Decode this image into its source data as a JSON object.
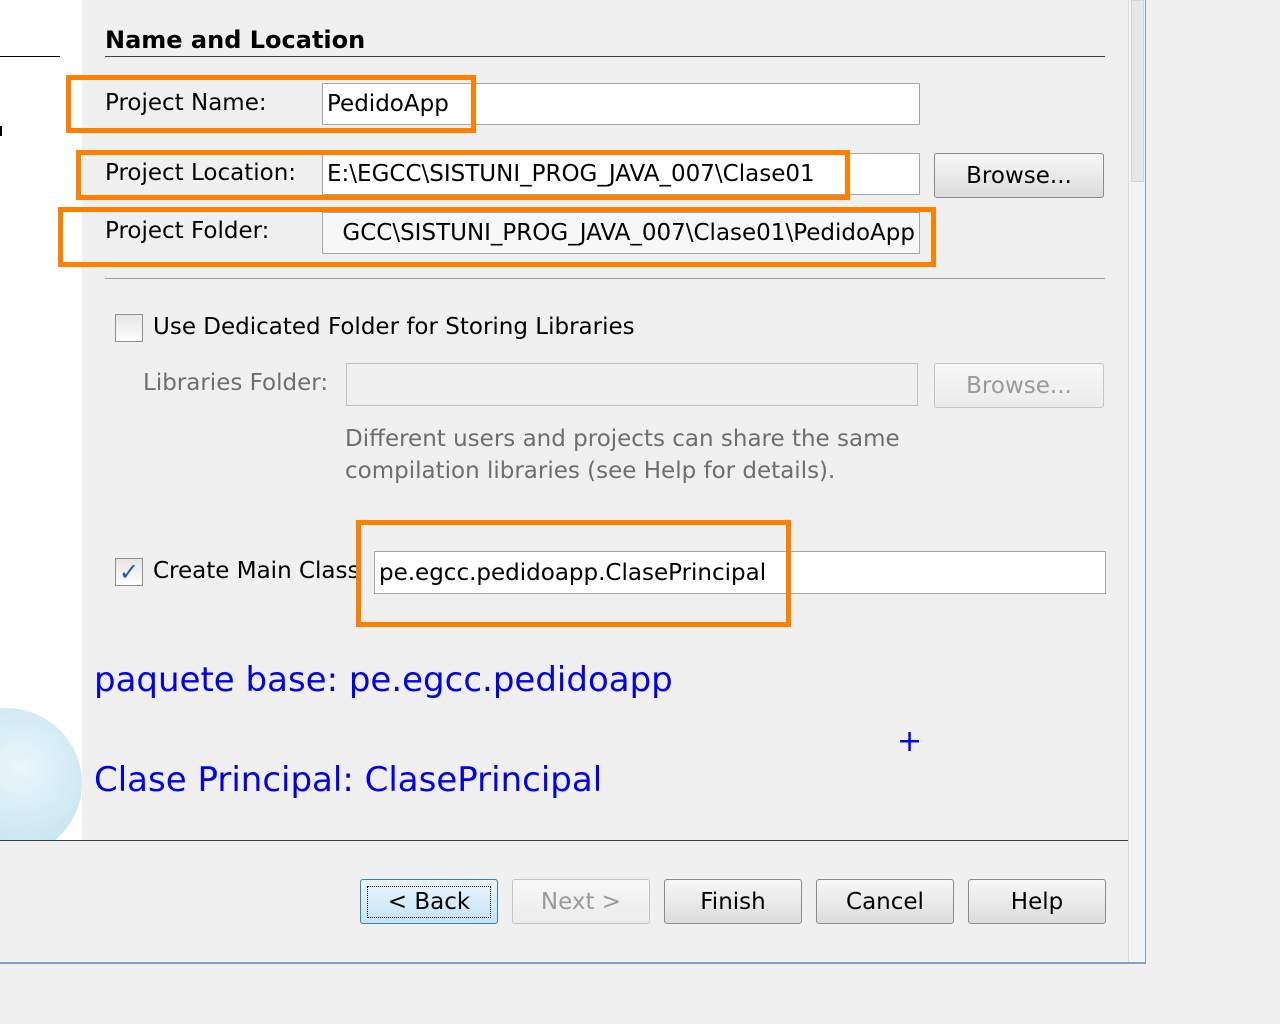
{
  "section_title": "Name and Location",
  "project_name": {
    "label": "Project Name:",
    "value": "PedidoApp"
  },
  "project_location": {
    "label": "Project Location:",
    "value": "E:\\EGCC\\SISTUNI_PROG_JAVA_007\\Clase01",
    "browse_label": "Browse..."
  },
  "project_folder": {
    "label": "Project Folder:",
    "value": "GCC\\SISTUNI_PROG_JAVA_007\\Clase01\\PedidoApp"
  },
  "libraries": {
    "checkbox_label": "Use Dedicated Folder for Storing Libraries",
    "checked": false,
    "folder_label": "Libraries Folder:",
    "folder_value": "",
    "browse_label": "Browse...",
    "help_line1": "Different users and projects can share the same",
    "help_line2": "compilation libraries (see Help for details)."
  },
  "main_class": {
    "checkbox_label": "Create Main Class",
    "checked": true,
    "check_glyph": "✓",
    "value": "pe.egcc.pedidoapp.ClasePrincipal"
  },
  "annotations": {
    "package_note": "paquete base: pe.egcc.pedidoapp",
    "class_note": "Clase Principal: ClasePrincipal",
    "cursor_mark": "+"
  },
  "buttons": {
    "back": "< Back",
    "next": "Next >",
    "finish": "Finish",
    "cancel": "Cancel",
    "help": "Help"
  },
  "colors": {
    "highlight": "#ff8000",
    "annotation": "#0000ee",
    "frame": "#7aa3cc"
  }
}
